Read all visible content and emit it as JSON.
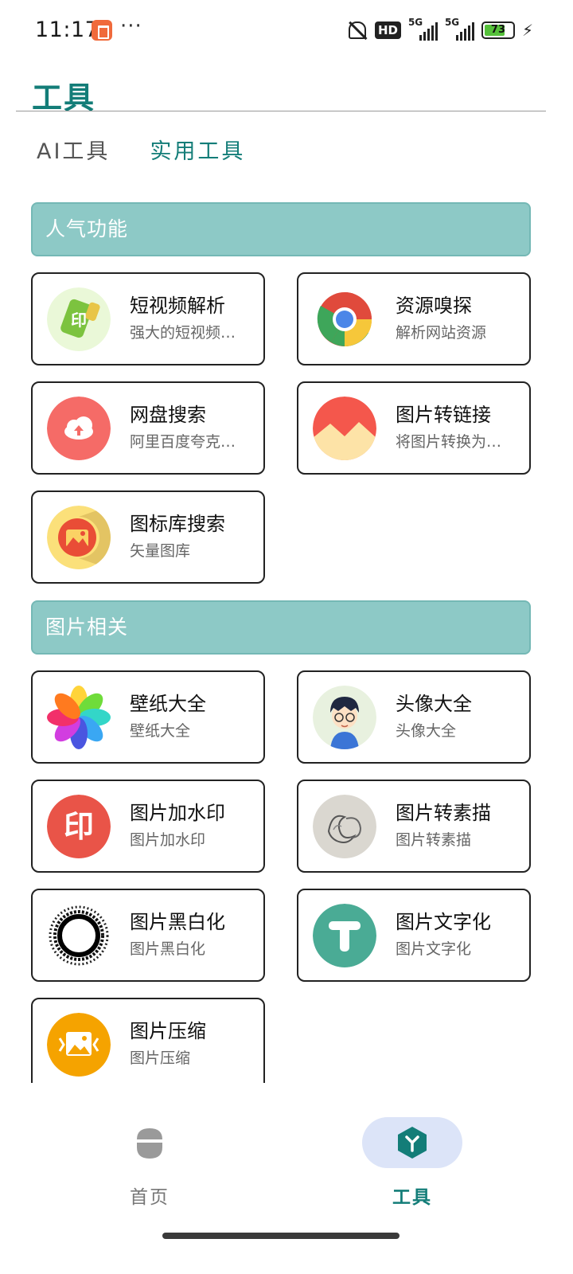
{
  "status_bar": {
    "time": "11:17",
    "dots": "···",
    "hd_label": "HD",
    "network_1": "5G",
    "network_2": "5G",
    "battery_level": "73",
    "battery_fraction": 0.73
  },
  "header": {
    "title": "工具"
  },
  "tabs": [
    {
      "label": "AI工具",
      "active": false
    },
    {
      "label": "实用工具",
      "active": true
    }
  ],
  "sections": {
    "popular": {
      "title": "人气功能",
      "cards": [
        {
          "name": "短视频解析",
          "desc": "强大的短视频解析工具"
        },
        {
          "name": "资源嗅探",
          "desc": "解析网站资源"
        },
        {
          "name": "网盘搜索",
          "desc": "阿里百度夸克网盘搜索"
        },
        {
          "name": "图片转链接",
          "desc": "将图片转换为链接"
        },
        {
          "name": "图标库搜索",
          "desc": "矢量图库"
        }
      ]
    },
    "image": {
      "title": "图片相关",
      "cards": [
        {
          "name": "壁纸大全",
          "desc": "壁纸大全"
        },
        {
          "name": "头像大全",
          "desc": "头像大全"
        },
        {
          "name": "图片加水印",
          "desc": "图片加水印"
        },
        {
          "name": "图片转素描",
          "desc": "图片转素描"
        },
        {
          "name": "图片黑白化",
          "desc": "图片黑白化"
        },
        {
          "name": "图片文字化",
          "desc": "图片文字化"
        },
        {
          "name": "图片压缩",
          "desc": "图片压缩"
        }
      ]
    }
  },
  "icons": {
    "video_parse": "video-parse-icon",
    "resource_sniff": "chrome-icon",
    "pan_search": "cloud-upload-icon",
    "image_link": "image-mountain-icon",
    "icon_search": "icon-library-icon",
    "wallpaper": "flower-petals-icon",
    "avatar": "cartoon-avatar-icon",
    "watermark": "watermark-yin-icon",
    "sketch": "sketch-icon",
    "bw": "black-white-ring-icon",
    "text": "letter-t-icon",
    "compress": "compress-image-icon"
  },
  "colors": {
    "accent": "#137d78",
    "section_header": "#8dc9c6",
    "nav_pill": "#dce4f8"
  },
  "bottom_nav": [
    {
      "label": "首页",
      "active": false
    },
    {
      "label": "工具",
      "active": true
    }
  ]
}
